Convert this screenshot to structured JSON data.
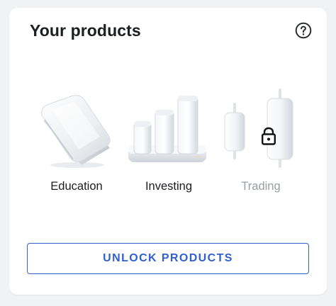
{
  "card": {
    "title": "Your products",
    "help_icon": "question-circle-icon"
  },
  "products": [
    {
      "label": "Education",
      "icon": "book-icon",
      "locked": false
    },
    {
      "label": "Investing",
      "icon": "bar-chart-icon",
      "locked": false
    },
    {
      "label": "Trading",
      "icon": "candlestick-icon",
      "locked": true,
      "lock_icon": "lock-icon"
    }
  ],
  "actions": {
    "unlock_label": "UNLOCK PRODUCTS"
  },
  "colors": {
    "accent": "#2f5fd1",
    "text": "#1b1d21",
    "muted": "#9a9ea4",
    "background": "#f1f2f4",
    "card": "#ffffff"
  }
}
